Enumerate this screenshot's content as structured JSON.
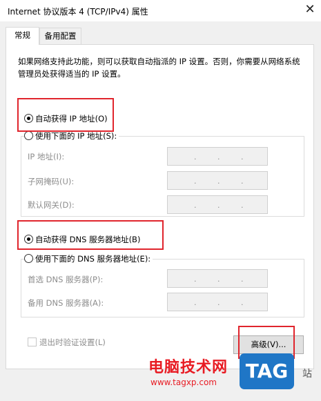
{
  "window": {
    "title": "Internet 协议版本 4 (TCP/IPv4) 属性",
    "close_glyph": "✕"
  },
  "tabs": [
    {
      "label": "常规",
      "selected": true
    },
    {
      "label": "备用配置",
      "selected": false
    }
  ],
  "description": "如果网络支持此功能，则可以获取自动指派的 IP 设置。否则，你需要从网络系统管理员处获得适当的 IP 设置。",
  "ip_section": {
    "auto_label": "自动获得 IP 地址(O)",
    "auto_selected": true,
    "manual_label": "使用下面的 IP 地址(S):",
    "manual_selected": false,
    "fields": [
      {
        "label": "IP 地址(I):",
        "value": "   .   .   ."
      },
      {
        "label": "子网掩码(U):",
        "value": "   .   .   ."
      },
      {
        "label": "默认网关(D):",
        "value": "   .   .   ."
      }
    ]
  },
  "dns_section": {
    "auto_label": "自动获得 DNS 服务器地址(B)",
    "auto_selected": true,
    "manual_label": "使用下面的 DNS 服务器地址(E):",
    "manual_selected": false,
    "fields": [
      {
        "label": "首选 DNS 服务器(P):",
        "value": "   .   .   ."
      },
      {
        "label": "备用 DNS 服务器(A):",
        "value": "   .   .   ."
      }
    ]
  },
  "validate_label": "退出时验证设置(L)",
  "advanced_button": "高级(V)...",
  "watermark": {
    "site_name": "电脑技术网",
    "url": "www.tagxp.com",
    "logo": "TAG",
    "tail": "站"
  },
  "colors": {
    "highlight_box": "#e0242c",
    "watermark": "#e81b23",
    "logo_bg": "#1f76c6"
  }
}
